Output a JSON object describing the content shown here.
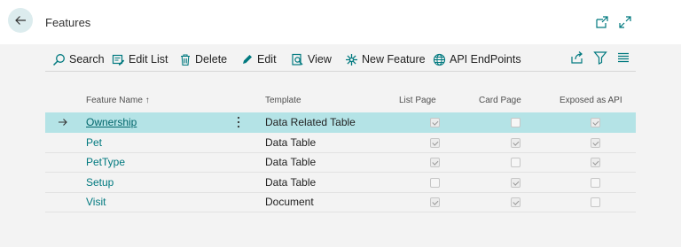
{
  "header": {
    "title": "Features"
  },
  "toolbar": {
    "search": "Search",
    "edit_list": "Edit List",
    "delete": "Delete",
    "edit": "Edit",
    "view": "View",
    "new_feature": "New Feature",
    "api_endpoints": "API EndPoints"
  },
  "columns": {
    "feature_name": "Feature Name ↑",
    "template": "Template",
    "list_page": "List Page",
    "card_page": "Card Page",
    "exposed_as_api": "Exposed as API"
  },
  "rows": [
    {
      "name": "Ownership",
      "template": "Data Related Table",
      "list_page": true,
      "card_page": false,
      "exposed_as_api": true,
      "selected": true
    },
    {
      "name": "Pet",
      "template": "Data Table",
      "list_page": true,
      "card_page": true,
      "exposed_as_api": true,
      "selected": false
    },
    {
      "name": "PetType",
      "template": "Data Table",
      "list_page": true,
      "card_page": false,
      "exposed_as_api": true,
      "selected": false
    },
    {
      "name": "Setup",
      "template": "Data Table",
      "list_page": false,
      "card_page": true,
      "exposed_as_api": false,
      "selected": false
    },
    {
      "name": "Visit",
      "template": "Document",
      "list_page": true,
      "card_page": true,
      "exposed_as_api": false,
      "selected": false
    }
  ],
  "colors": {
    "accent": "#00797f",
    "selected_row": "#b4e3e6",
    "back_button_bg": "#dcecee"
  },
  "icons": [
    "back-arrow-icon",
    "open-new-window-icon",
    "expand-icon",
    "search-icon",
    "edit-list-icon",
    "delete-icon",
    "edit-icon",
    "view-icon",
    "new-feature-icon",
    "api-globe-icon",
    "share-icon",
    "filter-icon",
    "list-view-icon",
    "row-arrow-icon",
    "row-menu-icon"
  ]
}
